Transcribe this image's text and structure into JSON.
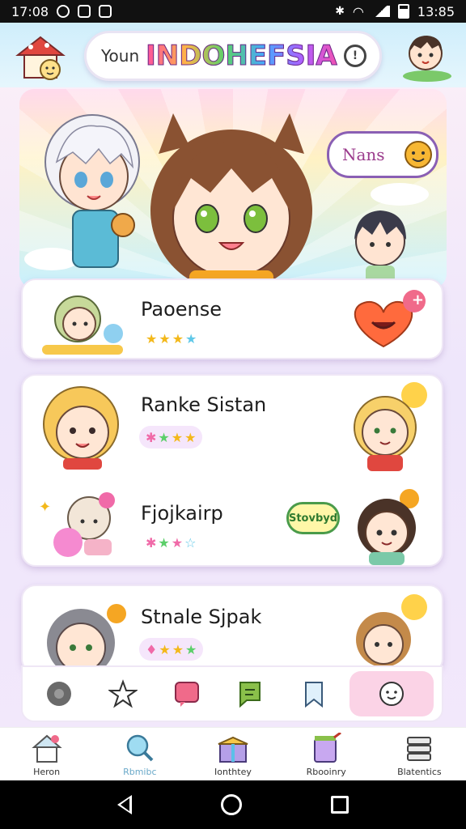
{
  "status_bar": {
    "time_left": "17:08",
    "time_right": "13:85"
  },
  "header": {
    "search_prefix": "Youn",
    "search_title": "INDOHEFSIA",
    "info_label": "!"
  },
  "hero": {
    "speech_text": "Nans"
  },
  "cards": [
    {
      "rows": [
        {
          "title": "Paoense",
          "stars": [
            "gold",
            "gold",
            "gold",
            "blue"
          ],
          "stars_bg": false
        }
      ],
      "badge": "+"
    },
    {
      "rows": [
        {
          "title": "Ranke Sistan",
          "stars": [
            "pink",
            "green",
            "gold",
            "gold"
          ],
          "stars_bg": true
        },
        {
          "title": "Fjojkairp",
          "stars": [
            "pink",
            "green",
            "pink",
            "blue"
          ],
          "stars_bg": false,
          "tag": "Stovbyd"
        }
      ]
    },
    {
      "rows": [
        {
          "title": "Stnale Sjpak",
          "stars": [
            "pink",
            "gold",
            "gold",
            "green"
          ],
          "stars_bg": true
        }
      ]
    }
  ],
  "bottom_nav": {
    "items": [
      {
        "label": "Heron",
        "icon": "house-icon"
      },
      {
        "label": "Rbmibc",
        "icon": "magnifier-icon",
        "active": true
      },
      {
        "label": "Ionthtey",
        "icon": "gift-box-icon"
      },
      {
        "label": "Rbooinry",
        "icon": "paint-bucket-icon"
      },
      {
        "label": "Blatentics",
        "icon": "stack-icon"
      }
    ]
  },
  "colors": {
    "accent_pink": "#fbd3e6",
    "header_bg": "#cfeefb",
    "active_label": "#6aa9c9"
  }
}
